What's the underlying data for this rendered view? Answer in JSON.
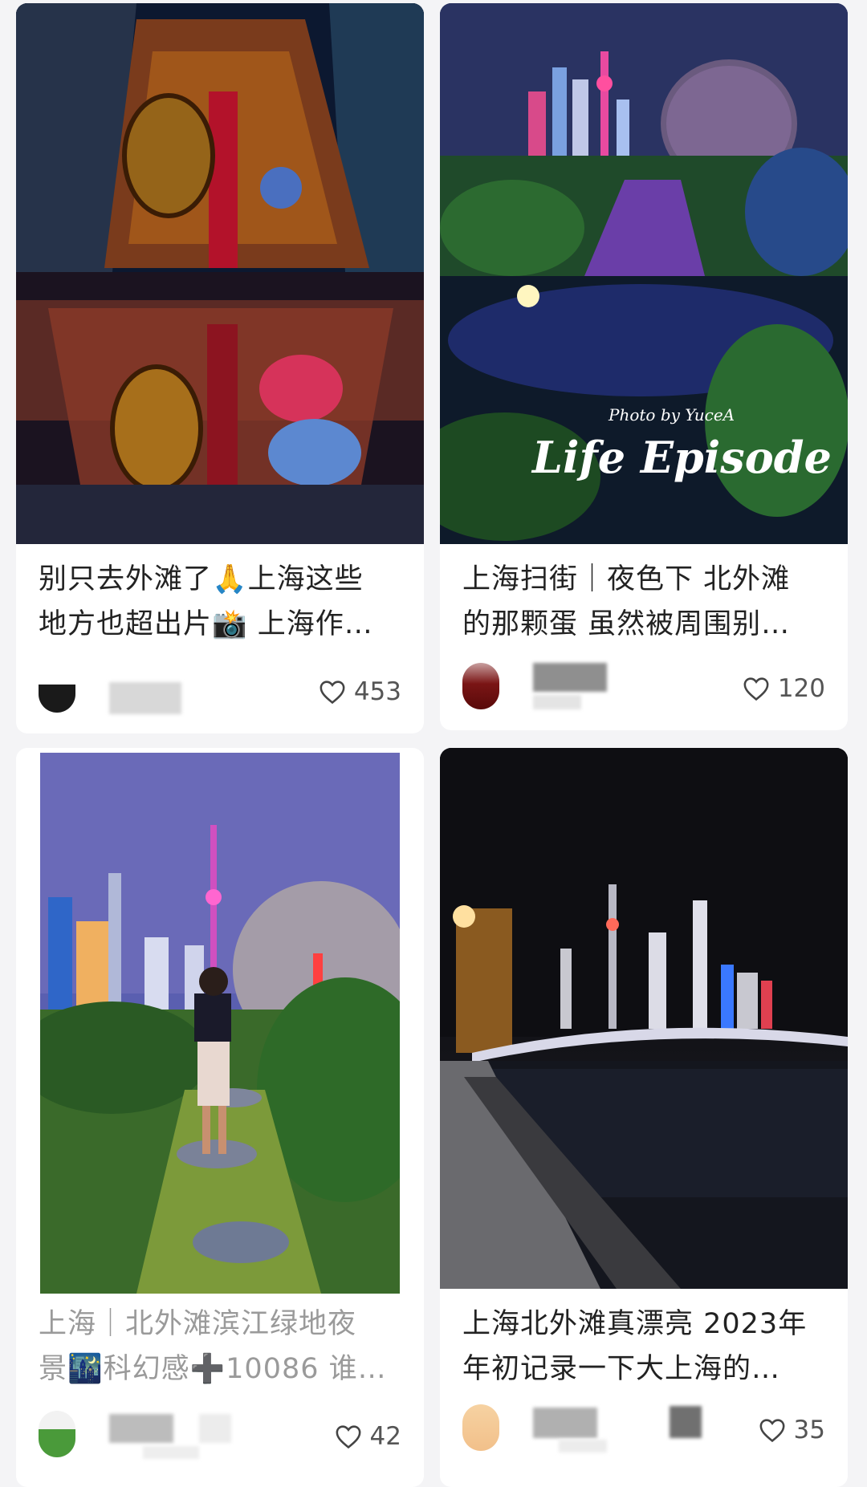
{
  "feed": [
    {
      "title_line1": "别只去外滩了🙏上海这些",
      "title_line2": "地方也超出片📸 上海作…",
      "likes": "453",
      "photo_icon": "night-building-egg-lanterns"
    },
    {
      "title_line1": "上海扫街｜夜色下 北外滩",
      "title_line2": "的那颗蛋 虽然被周围别…",
      "likes": "120",
      "photo_overlay_sig": "Photo by YuceA",
      "photo_overlay_title": "Life Episode",
      "photo_icon": "skyline-dome-garden"
    },
    {
      "title_line1": "上海｜北外滩滨江绿地夜",
      "title_line2": "景🌃科幻感➕10086 谁…",
      "likes": "42",
      "photo_icon": "girl-garden-skyline"
    },
    {
      "title_line1": "上海北外滩真漂亮 2023年",
      "title_line2": "年初记录一下大上海的…",
      "likes": "35",
      "photo_icon": "bund-river-night"
    }
  ],
  "icons": {
    "like": "heart-outline-icon"
  },
  "colors": {
    "bg": "#f4f4f6",
    "card": "#ffffff",
    "text": "#222222",
    "muted": "#555555"
  }
}
